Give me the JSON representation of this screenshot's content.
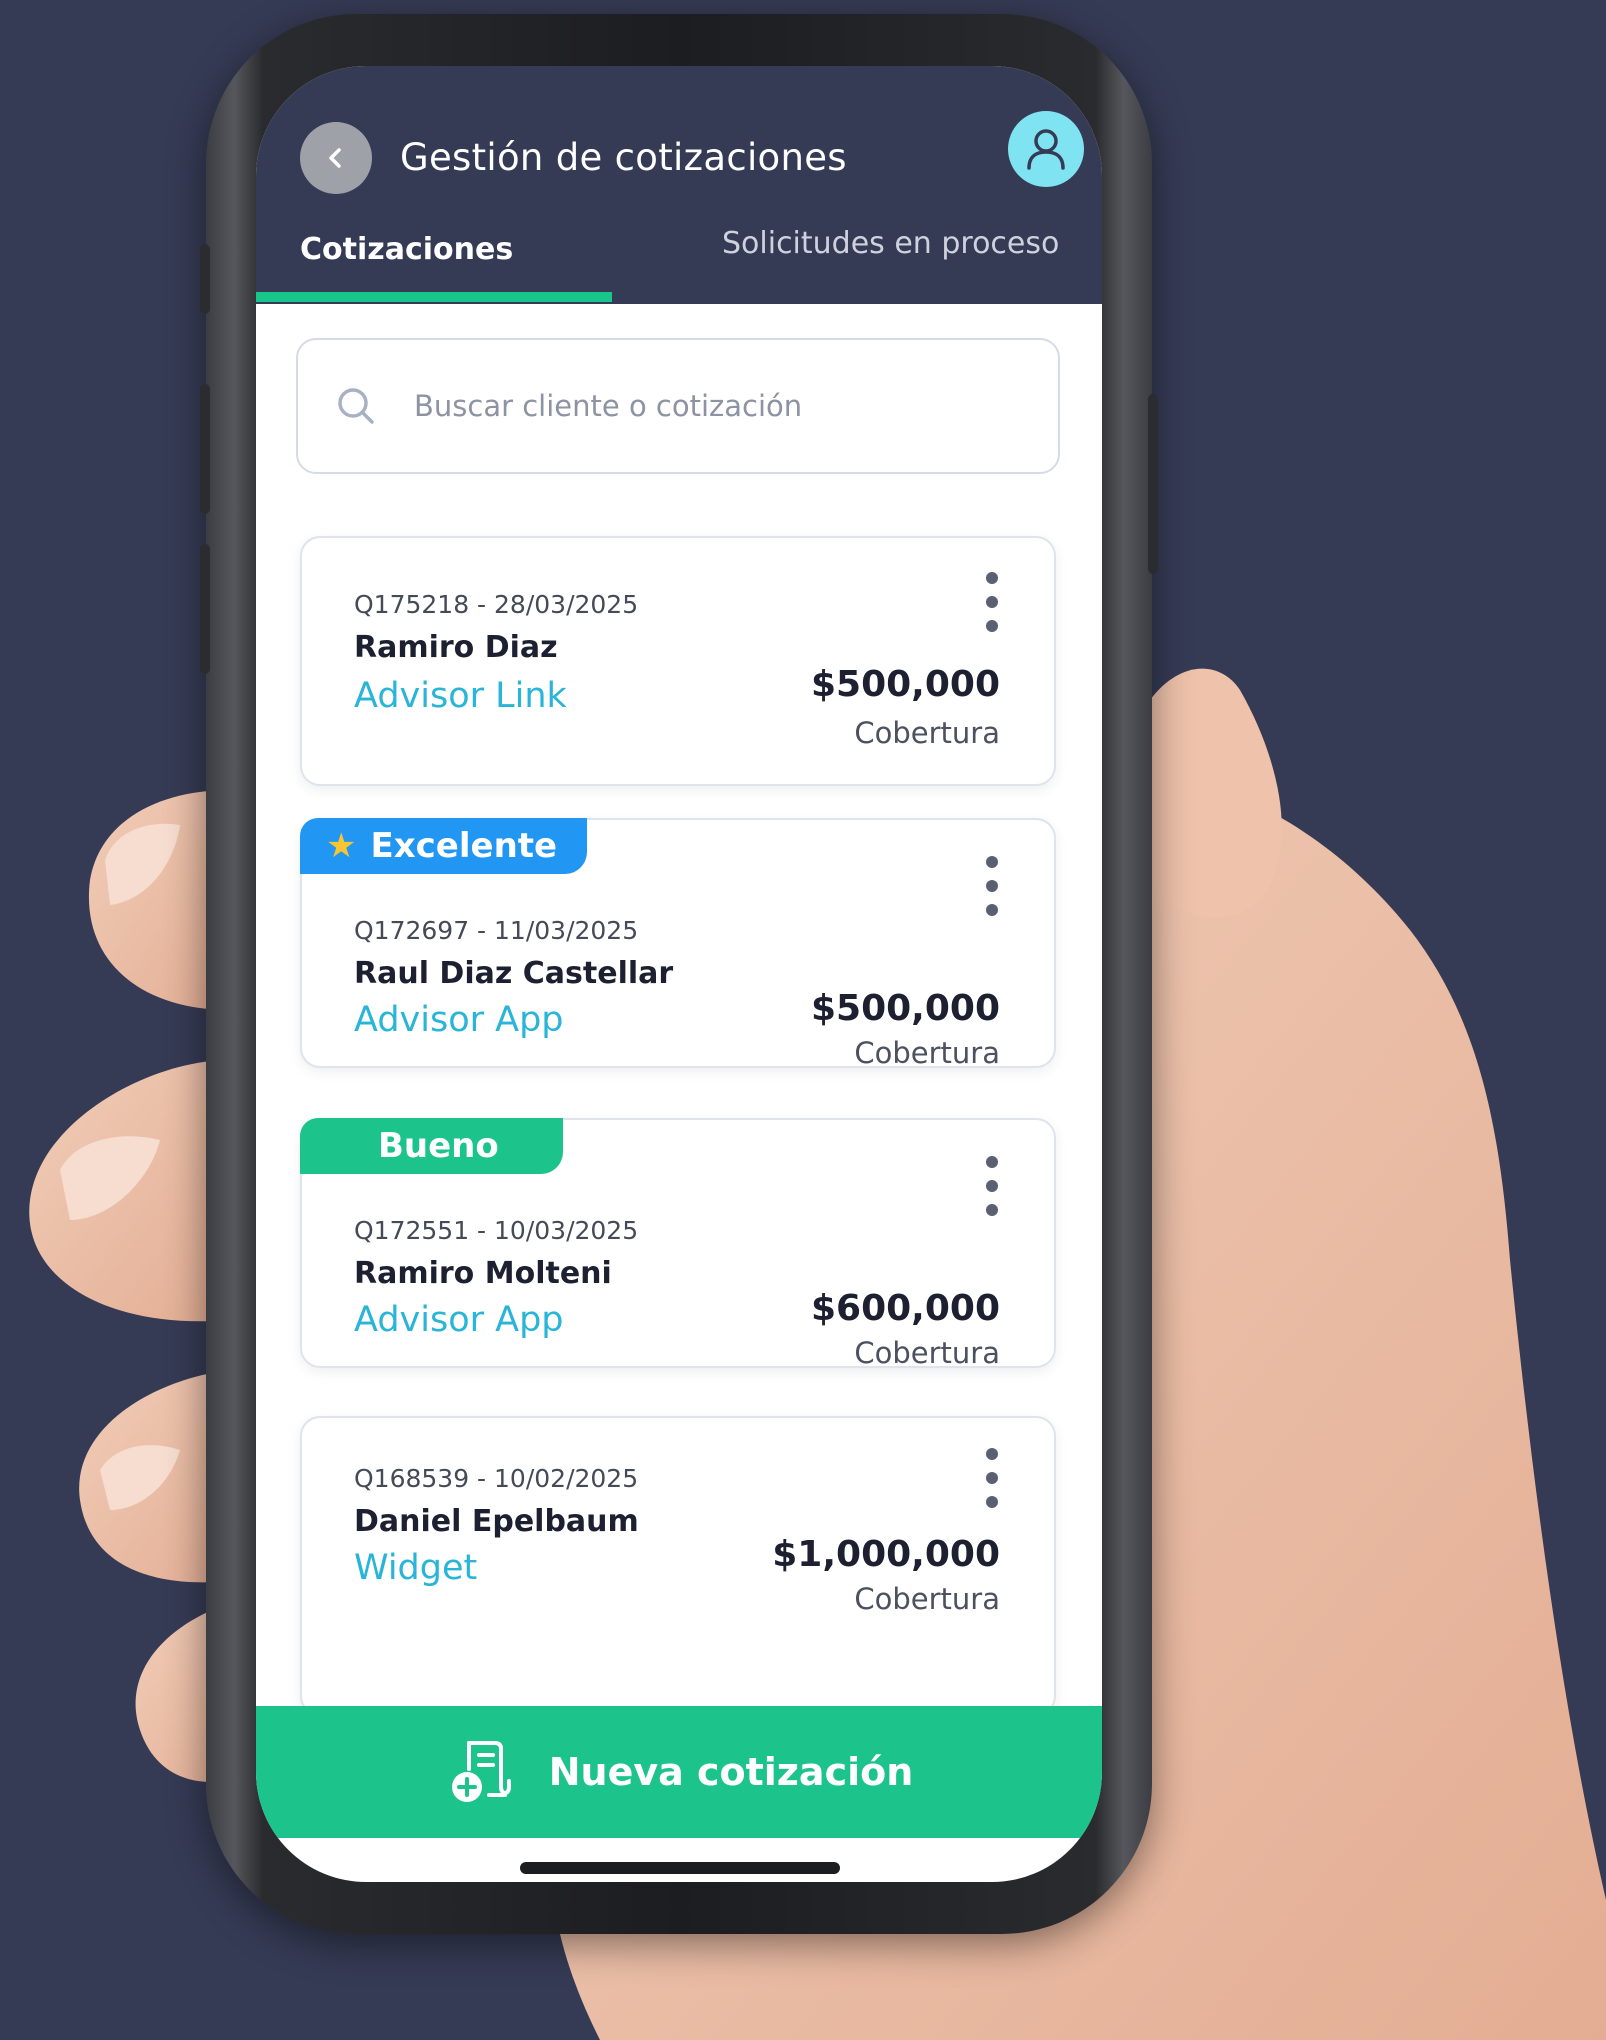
{
  "header": {
    "title": "Gestión de cotizaciones"
  },
  "tabs": [
    {
      "label": "Cotizaciones",
      "active": true
    },
    {
      "label": "Solicitudes en proceso",
      "active": false
    }
  ],
  "search": {
    "placeholder": "Buscar cliente o cotización"
  },
  "quotes": [
    {
      "badge": "",
      "id_date": "Q175218 - 28/03/2025",
      "client": "Ramiro  Diaz",
      "source": "Advisor Link",
      "amount": "$500,000",
      "coverage_label": "Cobertura"
    },
    {
      "badge": "Excelente",
      "id_date": "Q172697 - 11/03/2025",
      "client": "Raul Diaz Castellar",
      "source": "Advisor App",
      "amount": "$500,000",
      "coverage_label": "Cobertura"
    },
    {
      "badge": "Bueno",
      "id_date": "Q172551 - 10/03/2025",
      "client": "Ramiro Molteni",
      "source": "Advisor App",
      "amount": "$600,000",
      "coverage_label": "Cobertura"
    },
    {
      "badge": "",
      "id_date": "Q168539 - 10/02/2025",
      "client": "Daniel  Epelbaum",
      "source": "Widget",
      "amount": "$1,000,000",
      "coverage_label": "Cobertura"
    }
  ],
  "actions": {
    "new_quote_label": "Nueva cotización"
  },
  "colors": {
    "background": "#363b55",
    "header": "#363b55",
    "accent_green": "#1cc48b",
    "badge_excelente": "#2196f3",
    "badge_bueno": "#1cc48b",
    "source_link": "#29b5d8",
    "avatar": "#7fe3f2"
  },
  "icons": {
    "back": "chevron-left-icon",
    "profile": "user-icon",
    "search": "search-icon",
    "more": "kebab-menu-icon",
    "star": "star-icon",
    "new_quote": "document-plus-icon"
  }
}
